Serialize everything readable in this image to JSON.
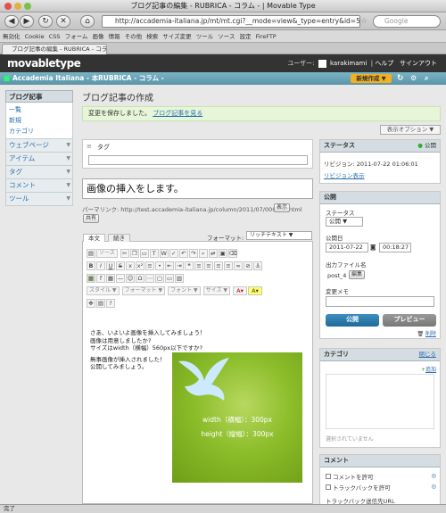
{
  "browser": {
    "window_title": "ブログ記事の編集 - RUBRICA - コラム - | Movable Type",
    "url": "http://accademia-italiana.jp/mt/mt.cgi?__mode=view&_type=entry&id=5&blog_id=2&s",
    "search_placeholder": "Google",
    "tab_title": "ブログ記事の編集 - RUBRICA - コラ...",
    "status": "完了",
    "bookmarks": [
      "無効化",
      "Cookie",
      "CSS",
      "フォーム",
      "画像",
      "情報",
      "その他",
      "検索",
      "サイズ変更",
      "ツール",
      "ソース",
      "設定",
      "FireFTP"
    ]
  },
  "mt": {
    "logo": "movabletype",
    "user_label": "ユーザー:",
    "username": "karakimami",
    "help": "ヘルプ",
    "signout": "サインアウト",
    "blog_parent": "Accademia Italiana - 本",
    "blog_name": "RUBRICA - コラム -",
    "new_post": "新規作成"
  },
  "sidebar": {
    "header": "ブログ記事",
    "sub": [
      "一覧",
      "新規",
      "カテゴリ"
    ],
    "items": [
      "ウェブページ",
      "アイテム",
      "タグ",
      "コメント",
      "ツール"
    ]
  },
  "page": {
    "title": "ブログ記事の作成",
    "message": "変更を保存しました。",
    "message_link": "ブログ記事を見る",
    "display_options": "表示オプション",
    "tag_label": "タグ",
    "entry_title": "画像の挿入をします。",
    "permalink_label": "パーマリンク:",
    "permalink_url": "http://test.accademia-italiana.jp/column/2011/07/000005.html",
    "view_btn": "表示",
    "share_btn": "共有"
  },
  "editor": {
    "tab_body": "本文",
    "tab_more": "続き",
    "format_label": "フォーマット:",
    "format_value": "リッチテキスト",
    "source_btn": "ソース",
    "style_dd": "スタイル",
    "format_dd": "フォーマット",
    "font_dd": "フォント",
    "size_dd": "サイズ",
    "body_lines": [
      "さあ、いよいよ画像を挿入してみましょう！",
      "画像は用意しましたか?",
      "サイズはwidth（横幅）560px以下ですか?",
      "",
      "無事画像が挿入されました！",
      "公開してみましょう。"
    ],
    "image_caption_w": "width（横幅）：300px",
    "image_caption_h": "height（縦幅）：300px"
  },
  "status_panel": {
    "header": "ステータス",
    "state": "公開",
    "revision": "リビジョン: 2011-07-22 01:06:01",
    "revision_link": "リビジョン表示"
  },
  "publish_panel": {
    "header": "公開",
    "status_label": "ステータス",
    "status_value": "公開",
    "date_label": "公開日",
    "date": "2011-07-22",
    "time": "00:18:27",
    "filename_label": "出力ファイル名",
    "filename": "post_4",
    "edit_btn": "編集",
    "note_label": "変更メモ",
    "publish_btn": "公開",
    "preview_btn": "プレビュー",
    "delete_link": "削除"
  },
  "category_panel": {
    "header": "カテゴリ",
    "close": "閉じる",
    "add": "追加",
    "empty": "選択されていません"
  },
  "comment_panel": {
    "header": "コメント",
    "allow_comments": "コメントを許可",
    "allow_trackbacks": "トラックバックを許可",
    "trackback_url": "トラックバック送信先URL"
  }
}
